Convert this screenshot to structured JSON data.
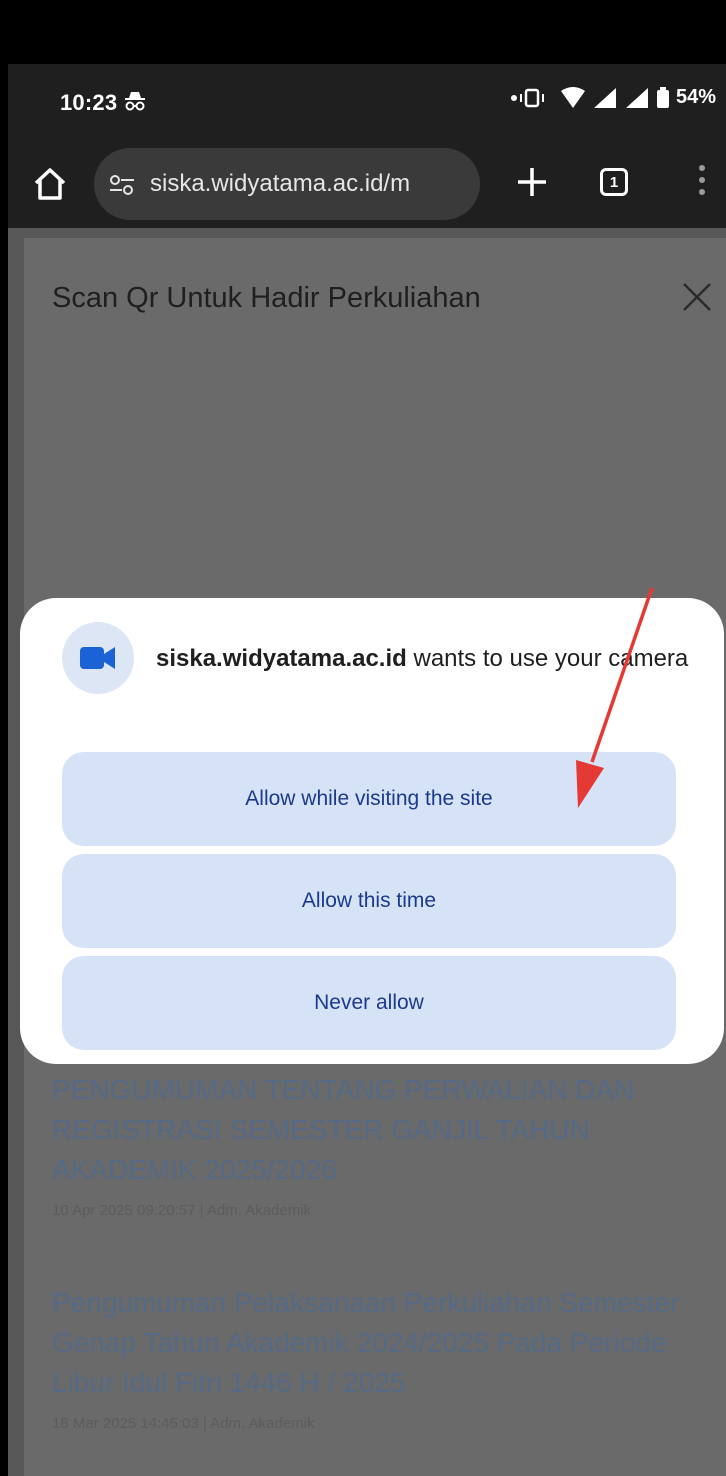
{
  "status_bar": {
    "time": "10:23",
    "battery": "54%"
  },
  "browser": {
    "url": "siska.widyatama.ac.id/m",
    "tab_count": "1"
  },
  "modal": {
    "title": "Scan Qr Untuk Hadir Perkuliahan"
  },
  "announcements": [
    {
      "title": "PENGUMUMAN TENTANG PERWALIAN DAN REGISTRASI SEMESTER GANJIL TAHUN AKADEMIK 2025/2026",
      "meta": "10 Apr 2025 09:20:57 | Adm. Akademik"
    },
    {
      "title": "Pengumuman Pelaksanaan Perkuliahan Semester Genap Tahun Akademik 2024/2025 Pada Periode Libur Idul Fitri 1446 H / 2025",
      "meta": "18 Mar 2025 14:45:03 | Adm. Akademik"
    }
  ],
  "permission_dialog": {
    "site": "siska.widyatama.ac.id",
    "message": " wants to use your camera",
    "allow_site_label": "Allow while visiting the site",
    "allow_once_label": "Allow this time",
    "never_label": "Never allow"
  },
  "colors": {
    "accent_button_bg": "#d6e3f7",
    "accent_button_text": "#1b3a8c",
    "annotation_arrow": "#e53935"
  }
}
